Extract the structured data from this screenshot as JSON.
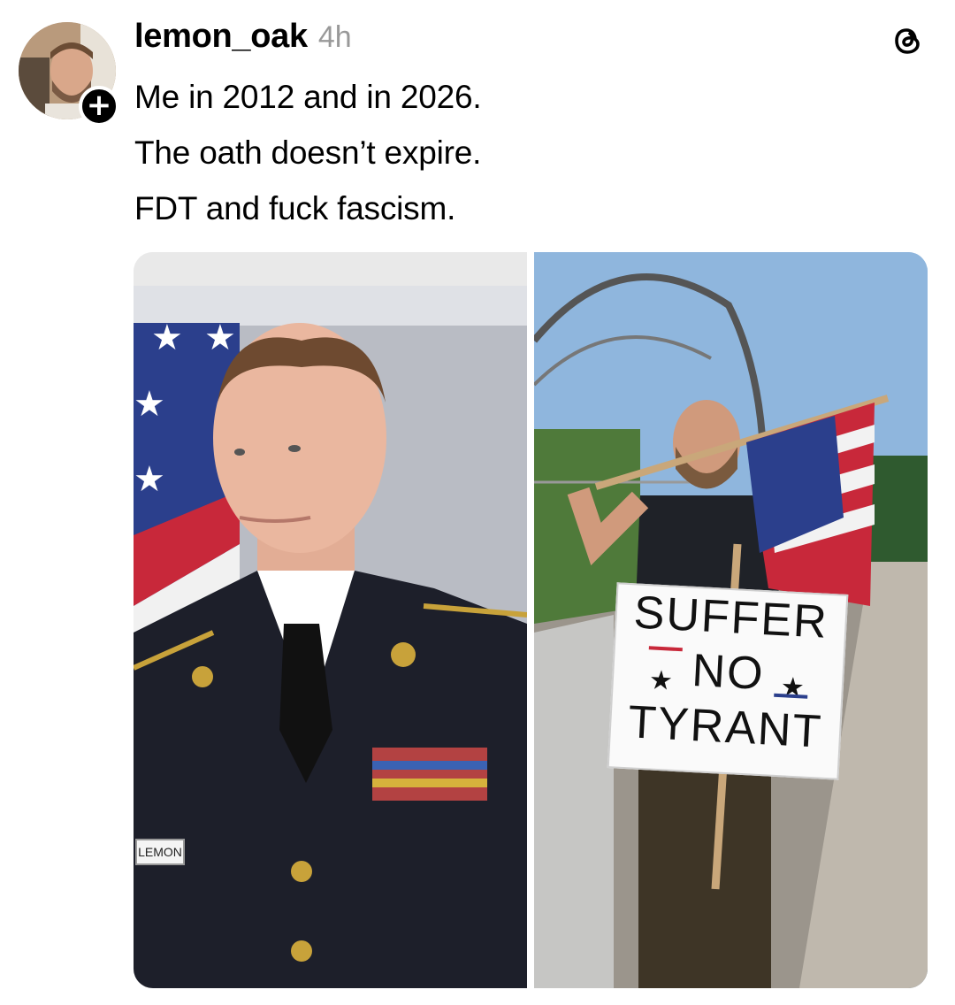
{
  "post": {
    "username": "lemon_oak",
    "time": "4h",
    "caption": [
      "Me in 2012 and in 2026.",
      "The oath doesn’t expire.",
      "FDT and fuck fascism."
    ]
  },
  "avatar": {
    "icon": "avatar",
    "follow_icon": "plus-icon",
    "follow_label": "+"
  },
  "app": {
    "icon": "threads-logo-icon"
  },
  "media": {
    "left_photo": {
      "name_tape": "LEMON"
    },
    "right_photo": {
      "sign": {
        "line1": "SUFFER",
        "line2": "NO",
        "line3": "TYRANT",
        "star": "★"
      }
    }
  },
  "colors": {
    "text": "#000000",
    "muted": "#999999",
    "background": "#ffffff",
    "sky": "#8fb6dd",
    "flag_red": "#c8283a",
    "flag_blue": "#2b3f8c"
  }
}
